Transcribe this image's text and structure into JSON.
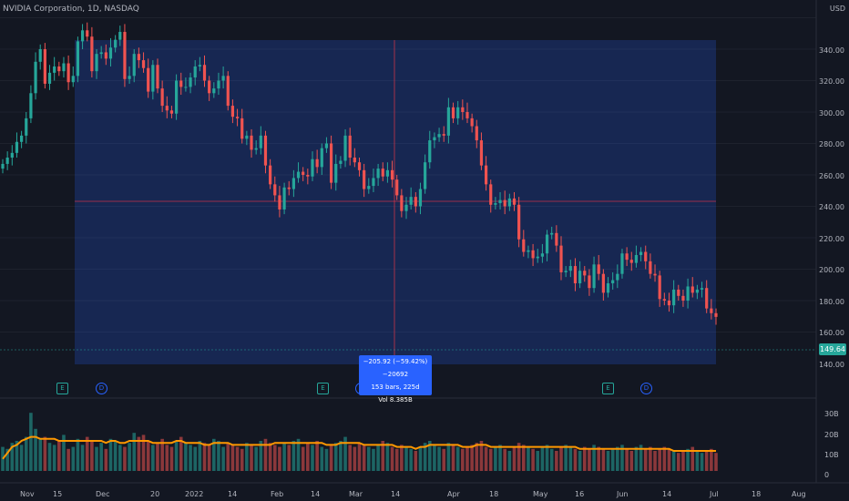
{
  "header": {
    "title": "NVIDIA Corporation, 1D, NASDAQ",
    "currency": "USD"
  },
  "price_axis": {
    "ticks": [
      "340.00",
      "320.00",
      "300.00",
      "280.00",
      "260.00",
      "240.00",
      "220.00",
      "200.00",
      "180.00",
      "160.00",
      "140.00"
    ],
    "last_price": "149.64"
  },
  "volume_axis": {
    "ticks": [
      "30B",
      "20B",
      "10B",
      "0"
    ]
  },
  "time_axis": {
    "labels": [
      "Nov",
      "15",
      "Dec",
      "20",
      "2022",
      "14",
      "Feb",
      "14",
      "Mar",
      "14",
      "Apr",
      "18",
      "May",
      "16",
      "Jun",
      "14",
      "Jul",
      "18",
      "Aug"
    ]
  },
  "measure_tooltip": {
    "line1": "−205.92 (−59.42%) −20692",
    "line2": "153 bars, 225d",
    "line3": "Vol 8.385B"
  },
  "events": {
    "earnings_label": "E",
    "dividend_label": "D"
  },
  "colors": {
    "up": "#26a69a",
    "down": "#ef5350",
    "ma": "#ff9800",
    "measure": "#2962ff",
    "crosshair": "#f23645"
  },
  "chart_data": {
    "type": "candlestick",
    "title": "NVIDIA Corporation, 1D, NASDAQ",
    "ylim": [
      130,
      350
    ],
    "close": [
      247,
      251,
      254,
      261,
      265,
      276,
      292,
      312,
      320,
      298,
      305,
      309,
      306,
      311,
      299,
      303,
      325,
      332,
      328,
      306,
      317,
      318,
      314,
      321,
      326,
      331,
      301,
      303,
      317,
      313,
      308,
      293,
      310,
      295,
      284,
      281,
      279,
      300,
      296,
      296,
      302,
      309,
      310,
      300,
      292,
      295,
      300,
      303,
      284,
      277,
      276,
      263,
      265,
      256,
      257,
      265,
      246,
      234,
      227,
      218,
      232,
      231,
      238,
      242,
      240,
      239,
      250,
      245,
      257,
      260,
      235,
      247,
      249,
      265,
      251,
      248,
      243,
      231,
      233,
      238,
      244,
      239,
      243,
      237,
      227,
      217,
      221,
      226,
      220,
      231,
      248,
      262,
      264,
      266,
      265,
      283,
      276,
      283,
      280,
      276,
      271,
      262,
      246,
      234,
      221,
      222,
      224,
      220,
      225,
      221,
      199,
      191,
      192,
      187,
      188,
      190,
      202,
      203,
      195,
      178,
      179,
      182,
      171,
      179,
      176,
      168,
      183,
      177,
      165,
      171,
      173,
      177,
      190,
      186,
      184,
      189,
      191,
      185,
      177,
      176,
      161,
      160,
      157,
      167,
      163,
      160,
      169,
      165,
      167,
      168,
      155,
      152,
      149.64
    ],
    "volume": [
      12,
      11,
      14,
      15,
      13,
      17,
      29,
      21,
      16,
      17,
      14,
      13,
      15,
      18,
      11,
      12,
      16,
      13,
      17,
      15,
      12,
      14,
      11,
      16,
      15,
      13,
      12,
      14,
      19,
      17,
      18,
      15,
      13,
      14,
      16,
      13,
      12,
      15,
      17,
      14,
      13,
      12,
      15,
      14,
      13,
      16,
      15,
      12,
      14,
      13,
      12,
      11,
      14,
      13,
      12,
      15,
      16,
      14,
      13,
      12,
      14,
      13,
      15,
      16,
      12,
      14,
      13,
      15,
      12,
      11,
      13,
      14,
      15,
      17,
      13,
      12,
      14,
      13,
      12,
      11,
      13,
      15,
      14,
      12,
      11,
      13,
      12,
      11,
      10,
      12,
      14,
      15,
      13,
      12,
      11,
      14,
      13,
      12,
      11,
      12,
      13,
      14,
      15,
      12,
      11,
      12,
      13,
      11,
      10,
      12,
      14,
      13,
      12,
      11,
      10,
      12,
      13,
      11,
      10,
      12,
      13,
      12,
      11,
      10,
      12,
      11,
      13,
      12,
      11,
      10,
      11,
      12,
      13,
      11,
      10,
      12,
      13,
      11,
      12,
      10,
      11,
      12,
      11,
      10,
      9,
      10,
      11,
      12,
      10,
      9,
      10,
      11,
      9
    ],
    "ma_volume": [
      6,
      9,
      12,
      13,
      15,
      16,
      17,
      17,
      16,
      16,
      16,
      16,
      15,
      15,
      15,
      15,
      15,
      15,
      15,
      15,
      15,
      15,
      14,
      15,
      15,
      14,
      14,
      15,
      15,
      15,
      15,
      15,
      14,
      14,
      14,
      14,
      14,
      15,
      15,
      14,
      14,
      14,
      14,
      13,
      13,
      14,
      14,
      14,
      14,
      13,
      13,
      13,
      13,
      13,
      13,
      13,
      13,
      13,
      14,
      14,
      14,
      14,
      14,
      14,
      14,
      14,
      14,
      14,
      14,
      13,
      13,
      13,
      14,
      14,
      14,
      14,
      14,
      13,
      13,
      13,
      13,
      13,
      13,
      13,
      12,
      12,
      12,
      12,
      11,
      12,
      12,
      13,
      13,
      13,
      13,
      13,
      13,
      13,
      12,
      12,
      12,
      13,
      13,
      13,
      12,
      12,
      12,
      12,
      12,
      12,
      12,
      12,
      12,
      12,
      12,
      12,
      12,
      12,
      12,
      12,
      12,
      12,
      12,
      11,
      11,
      11,
      11,
      11,
      11,
      11,
      11,
      11,
      11,
      11,
      11,
      11,
      11,
      11,
      11,
      11,
      11,
      11,
      11,
      10,
      10,
      10,
      10,
      10,
      10,
      10,
      10,
      10,
      10
    ],
    "measure": {
      "change": "−205.92",
      "percent": "−59.42%",
      "bars": 153,
      "days": 225,
      "volume": "8.385B"
    }
  }
}
